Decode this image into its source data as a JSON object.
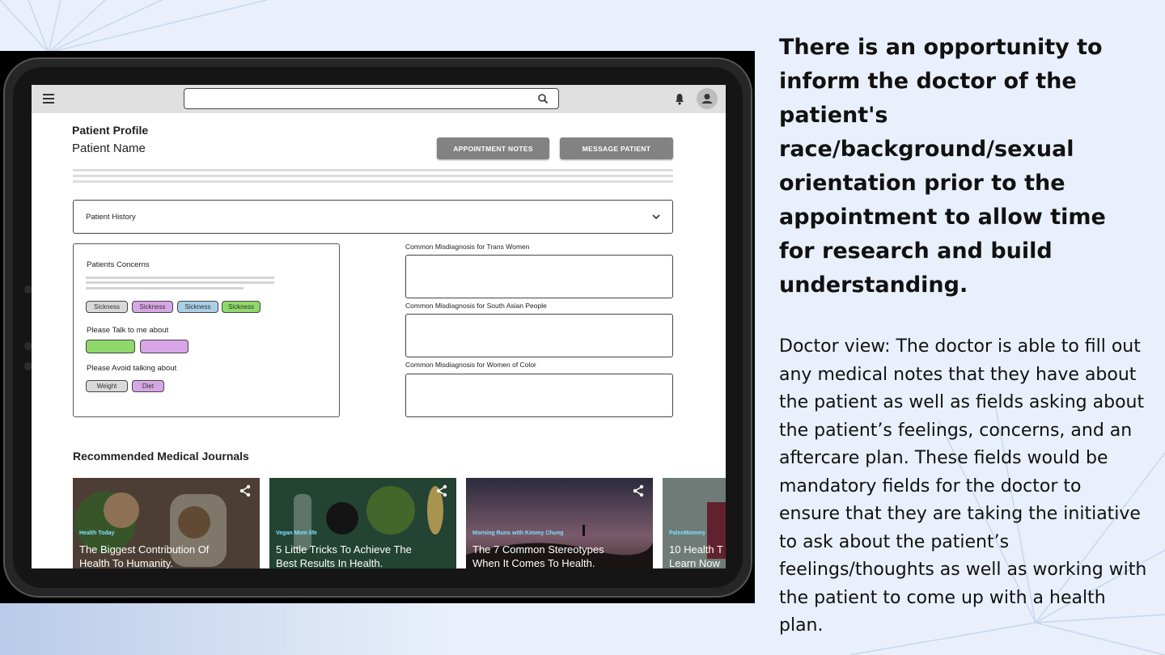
{
  "slide": {
    "heading": "There is an opportunity to inform the doctor of the patient's race/background/sexual orientation prior to the appointment to allow time for research and build understanding.",
    "description": "Doctor view: The doctor is able to fill out any medical notes that they have about the patient as well as fields asking about the patient’s feelings, concerns, and an aftercare plan. These fields would be mandatory fields for the doctor to ensure that they are taking the initiative to ask about the patient’s feelings/thoughts as well as working with the patient to come up with a health plan."
  },
  "app": {
    "header": {
      "title": "Patient Profile",
      "patient_name": "Patient Name",
      "appointment_notes_label": "APPOINTMENT NOTES",
      "message_patient_label": "MESSAGE PATIENT"
    },
    "history": {
      "label": "Patient History"
    },
    "concerns": {
      "title": "Patients Concerns",
      "tags": [
        "Sickness",
        "Sickness",
        "Sickness",
        "Sickness"
      ],
      "talk_about_label": "Please Talk to me about",
      "avoid_label": "Please Avoid talking about",
      "avoid_tags": [
        "Weight",
        "Diet"
      ]
    },
    "misdiagnosis": [
      {
        "label": "Common Misdiagnosis for Trans Women"
      },
      {
        "label": "Common Misdiagnosis for South Asian People"
      },
      {
        "label": "Common Misdiagnosis for Women of Color"
      }
    ],
    "journals": {
      "title": "Recommended Medical Journals",
      "cards": [
        {
          "source": "Health Today",
          "line1": "The Biggest Contribution Of",
          "line2": "Health To Humanity."
        },
        {
          "source": "Vegan Mom life",
          "line1": "5 Little Tricks To Achieve The",
          "line2": "Best Results In Health."
        },
        {
          "source": "Morning Runs with Kimmy Chung",
          "line1": "The 7 Common Stereotypes",
          "line2": "When It Comes To Health."
        },
        {
          "source": "PaleoMommy",
          "line1": "10 Health T",
          "line2": "Learn Now"
        }
      ]
    }
  },
  "colors": {
    "tag_gray": "#d9d9d9",
    "tag_pink": "#d8a6e6",
    "tag_blue": "#a9cfe6",
    "tag_green": "#8fd96a",
    "button_gray": "#828282",
    "source_blue": "#7ee0ff"
  },
  "icons": [
    "menu-icon",
    "search-icon",
    "bell-icon",
    "user-icon",
    "chevron-down-icon",
    "share-icon"
  ]
}
